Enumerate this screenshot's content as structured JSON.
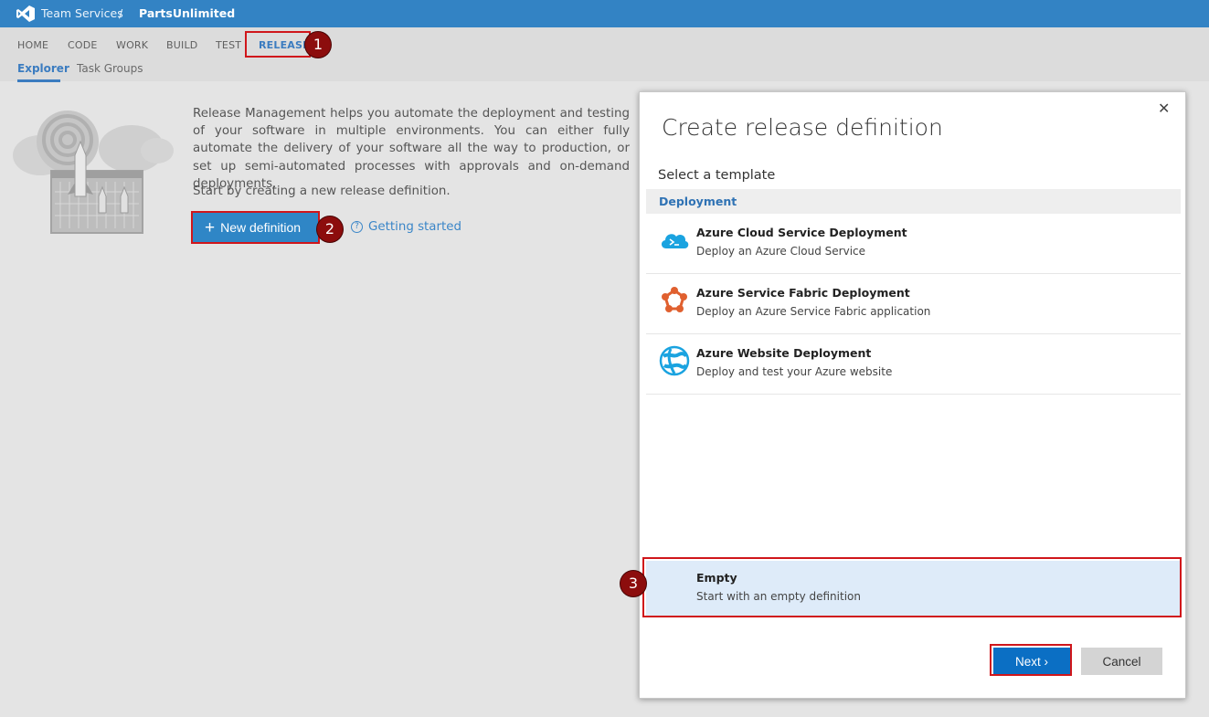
{
  "topbar": {
    "brand": "Team Services",
    "separator": "/",
    "project": "PartsUnlimited",
    "logo_icon": "visual-studio-icon"
  },
  "nav": {
    "items": [
      {
        "label": "HOME"
      },
      {
        "label": "CODE"
      },
      {
        "label": "WORK"
      },
      {
        "label": "BUILD"
      },
      {
        "label": "TEST"
      },
      {
        "label": "RELEASE",
        "active": true
      }
    ],
    "subitems": [
      {
        "label": "Explorer",
        "active": true
      },
      {
        "label": "Task Groups"
      }
    ]
  },
  "markers": [
    "1",
    "2",
    "3"
  ],
  "main": {
    "illustration_icon": "rocket-target-illustration",
    "description": "Release Management helps you automate the deployment and testing of your software in multiple environments. You can either fully automate the delivery of your software all the way to production, or set up semi-automated processes with approvals and on-demand deployments.",
    "start_text": "Start by creating a new release definition.",
    "new_definition_label": "New definition",
    "getting_started_label": "Getting started"
  },
  "dialog": {
    "title": "Create release definition",
    "select_label": "Select a template",
    "group": "Deployment",
    "templates": [
      {
        "name": "Azure Cloud Service Deployment",
        "desc": "Deploy an Azure Cloud Service",
        "icon": "azure-cloud-icon"
      },
      {
        "name": "Azure Service Fabric Deployment",
        "desc": "Deploy an Azure Service Fabric application",
        "icon": "service-fabric-icon"
      },
      {
        "name": "Azure Website Deployment",
        "desc": "Deploy and test your Azure website",
        "icon": "azure-website-icon"
      }
    ],
    "empty": {
      "name": "Empty",
      "desc": "Start with an empty definition"
    },
    "next_label": "Next ›",
    "cancel_label": "Cancel",
    "close_icon": "close-icon"
  },
  "colors": {
    "topbar": "#3383c4",
    "accent": "#3b7cc0",
    "highlight_box": "#d0161b",
    "marker": "#8c0d0d",
    "primary_button": "#0b6fc4"
  }
}
